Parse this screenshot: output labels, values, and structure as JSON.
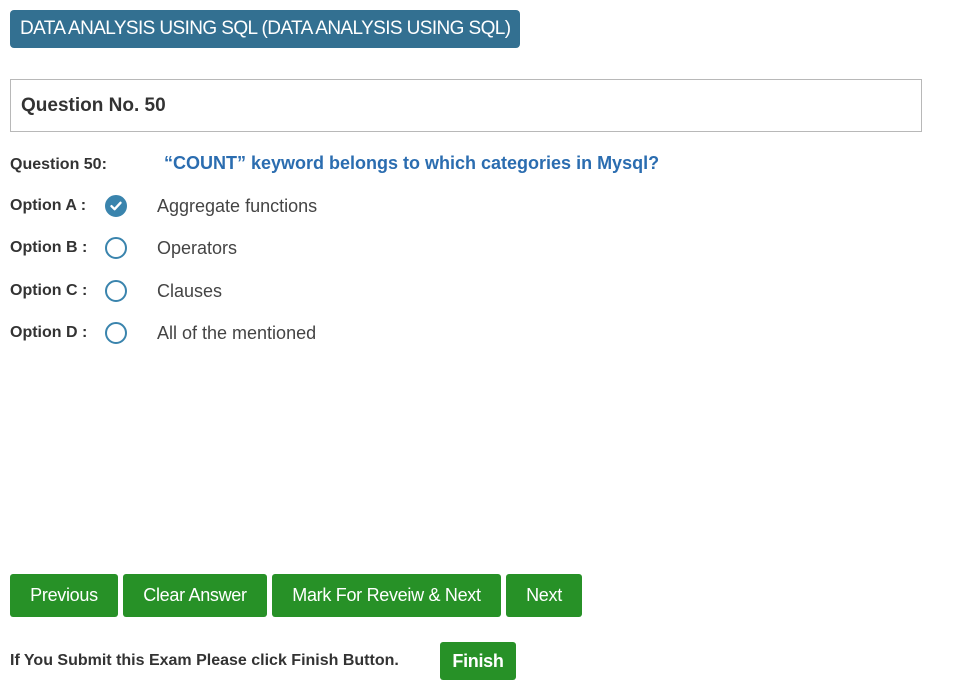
{
  "subject": {
    "title": "DATA ANALYSIS USING SQL (DATA ANALYSIS USING SQL)"
  },
  "question": {
    "header": "Question No. 50",
    "label": "Question 50:",
    "text": "“COUNT” keyword belongs to which categories in Mysql?"
  },
  "options": [
    {
      "label": "Option A :",
      "text": "Aggregate functions",
      "selected": true
    },
    {
      "label": "Option B :",
      "text": "Operators",
      "selected": false
    },
    {
      "label": "Option C :",
      "text": "Clauses",
      "selected": false
    },
    {
      "label": "Option D :",
      "text": "All of the mentioned",
      "selected": false
    }
  ],
  "navigation": {
    "previous_label": "Previous",
    "clear_label": "Clear Answer",
    "mark_review_label": "Mark For Reveiw & Next",
    "next_label": "Next"
  },
  "footer": {
    "instruction": "If You Submit this Exam Please click Finish Button.",
    "finish_label": "Finish"
  },
  "colors": {
    "subject_badge": "#337091",
    "question_text": "#2b6db0",
    "radio": "#3a84ad",
    "button": "#279127"
  },
  "icons": {
    "selected_radio": "check-icon"
  }
}
